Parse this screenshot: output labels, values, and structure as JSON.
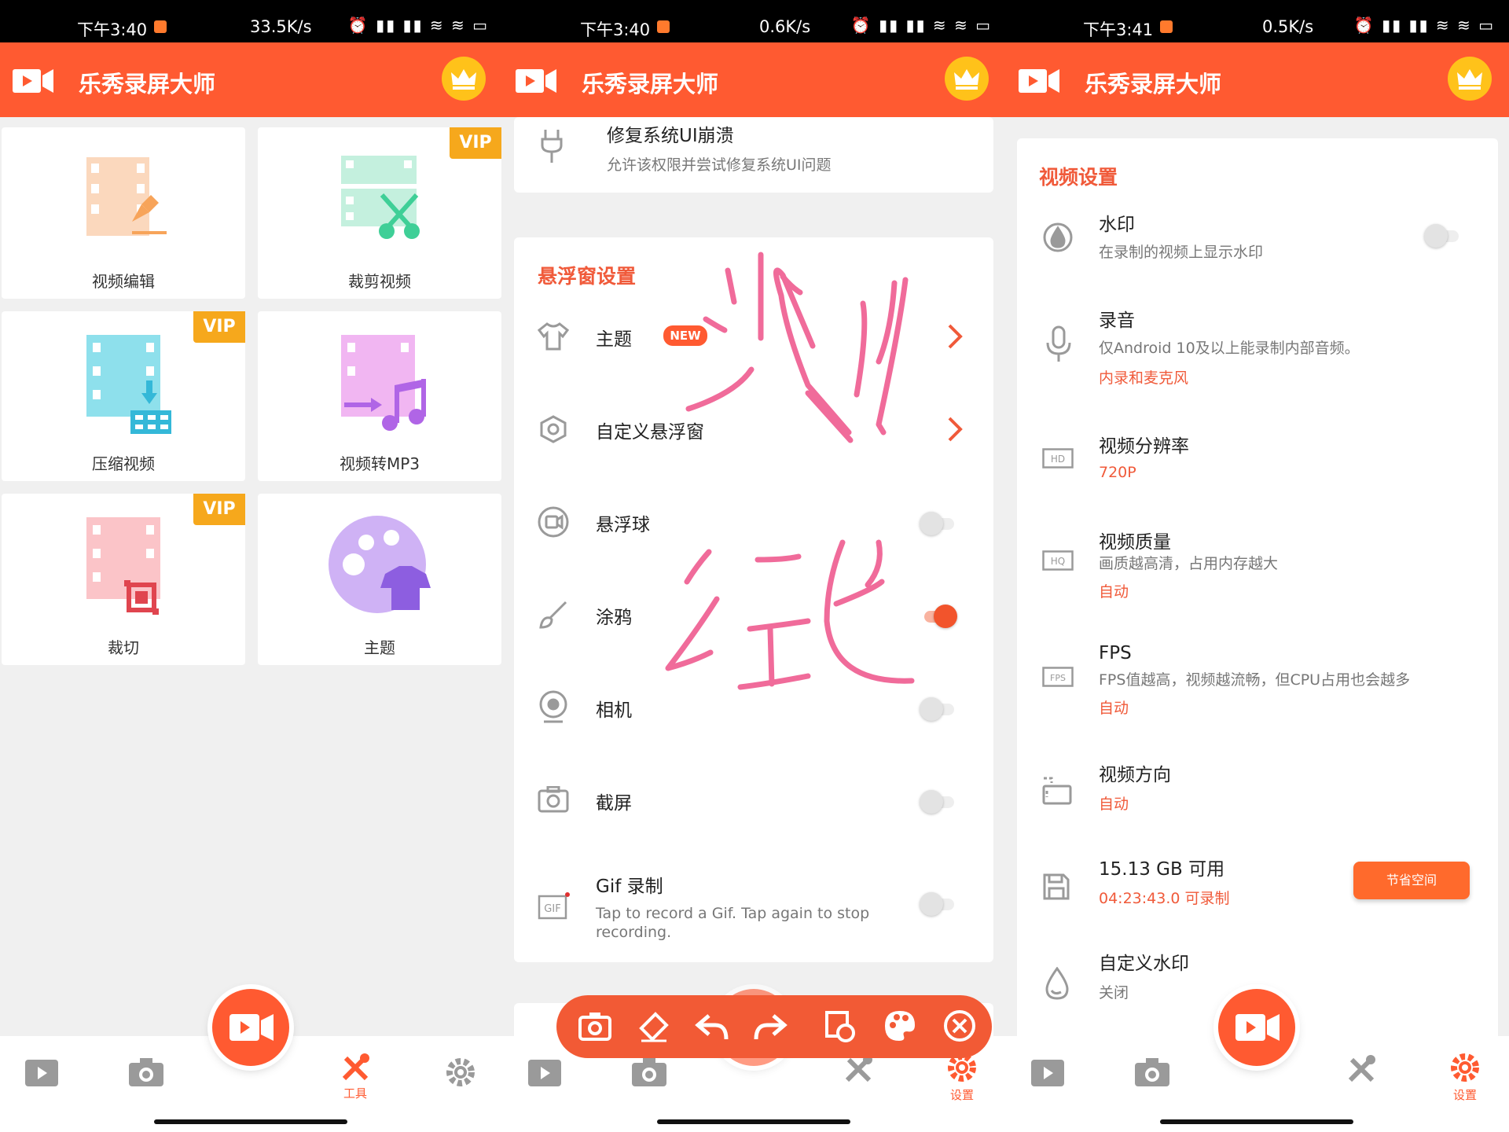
{
  "app": {
    "title": "乐秀录屏大师"
  },
  "panels": [
    {
      "status": {
        "time": "下午3:40",
        "speed": "33.5K/s"
      },
      "tiles": [
        {
          "label": "视频编辑"
        },
        {
          "label": "裁剪视频"
        },
        {
          "label": "压缩视频"
        },
        {
          "label": "视频转MP3"
        },
        {
          "label": "裁切"
        },
        {
          "label": "主题"
        }
      ],
      "vip": "VIP",
      "nav": {
        "tools": "工具"
      }
    },
    {
      "status": {
        "time": "下午3:40",
        "speed": "0.6K/s"
      },
      "repair": {
        "title": "修复系统UI崩溃",
        "desc": "允许该权限并尝试修复系统UI问题"
      },
      "section": "悬浮窗设置",
      "badge": "NEW",
      "rows": [
        {
          "title": "主题"
        },
        {
          "title": "自定义悬浮窗"
        },
        {
          "title": "悬浮球"
        },
        {
          "title": "涂鸦"
        },
        {
          "title": "相机"
        },
        {
          "title": "截屏"
        },
        {
          "title": "Gif 录制",
          "desc": "Tap to record a Gif. Tap again to stop recording."
        }
      ],
      "nav": {
        "settings": "设置"
      }
    },
    {
      "status": {
        "time": "下午3:41",
        "speed": "0.5K/s"
      },
      "section": "视频设置",
      "watermark": {
        "title": "水印",
        "desc": "在录制的视频上显示水印"
      },
      "audio": {
        "title": "录音",
        "desc": "仅Android 10及以上能录制内部音频。",
        "value": "内录和麦克风"
      },
      "resolution": {
        "title": "视频分辨率",
        "value": "720P"
      },
      "quality": {
        "title": "视频质量",
        "desc": "画质越高清，占用内存越大",
        "value": "自动"
      },
      "fps": {
        "title": "FPS",
        "desc": "FPS值越高，视频越流畅，但CPU占用也会越多",
        "value": "自动"
      },
      "orientation": {
        "title": "视频方向",
        "value": "自动"
      },
      "storage": {
        "title": "15.13 GB 可用",
        "value": "04:23:43.0 可录制",
        "button": "节省空间"
      },
      "custom_watermark": {
        "title": "自定义水印",
        "value": "关闭"
      },
      "nav": {
        "settings": "设置"
      }
    }
  ],
  "icons": {
    "hd": "HD",
    "hq": "HQ",
    "fps": "FPS",
    "gif": "GIF"
  },
  "doodle_text": "测试",
  "colors": {
    "accent": "#ff5a31",
    "section": "#f05a3a",
    "vip": "#f6a81c",
    "crown": "#ffc21a"
  }
}
